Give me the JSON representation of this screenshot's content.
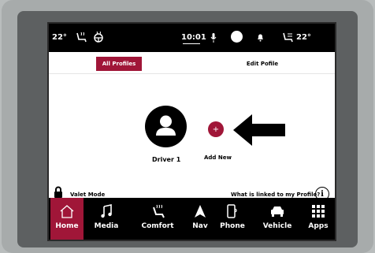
{
  "status_bar": {
    "temp_left": "22°",
    "time": "10:01",
    "temp_right": "22°",
    "icons": [
      "heated-seat-icon",
      "heated-steering-wheel-icon",
      "microphone-icon",
      "camera-icon",
      "notification-bell-icon",
      "ventilated-seat-icon"
    ]
  },
  "tabs": [
    {
      "label": "All Profiles",
      "active": true
    },
    {
      "label": "Edit Pofile",
      "active": false
    }
  ],
  "profiles": [
    {
      "name": "Driver 1",
      "icon": "person-avatar-icon"
    }
  ],
  "add_new": {
    "label": "Add New",
    "symbol": "+"
  },
  "valet": {
    "label": "Valet Mode",
    "icon": "lock-icon"
  },
  "linked": {
    "label": "What is linked to my Profile?",
    "icon": "info-icon",
    "symbol": "i"
  },
  "nav": [
    {
      "label": "Home",
      "icon": "home-icon",
      "active": true
    },
    {
      "label": "Media",
      "icon": "music-note-icon",
      "active": false
    },
    {
      "label": "Comfort",
      "icon": "seat-comfort-icon",
      "active": false
    },
    {
      "label": "Nav",
      "icon": "navigation-arrow-icon",
      "active": false
    },
    {
      "label": "Phone",
      "icon": "phone-icon",
      "active": false
    },
    {
      "label": "Vehicle",
      "icon": "car-icon",
      "active": false
    },
    {
      "label": "Apps",
      "icon": "grid-icon",
      "active": false
    }
  ],
  "colors": {
    "accent": "#a01638",
    "screen_bg": "#ffffff",
    "bar_bg": "#000000"
  }
}
